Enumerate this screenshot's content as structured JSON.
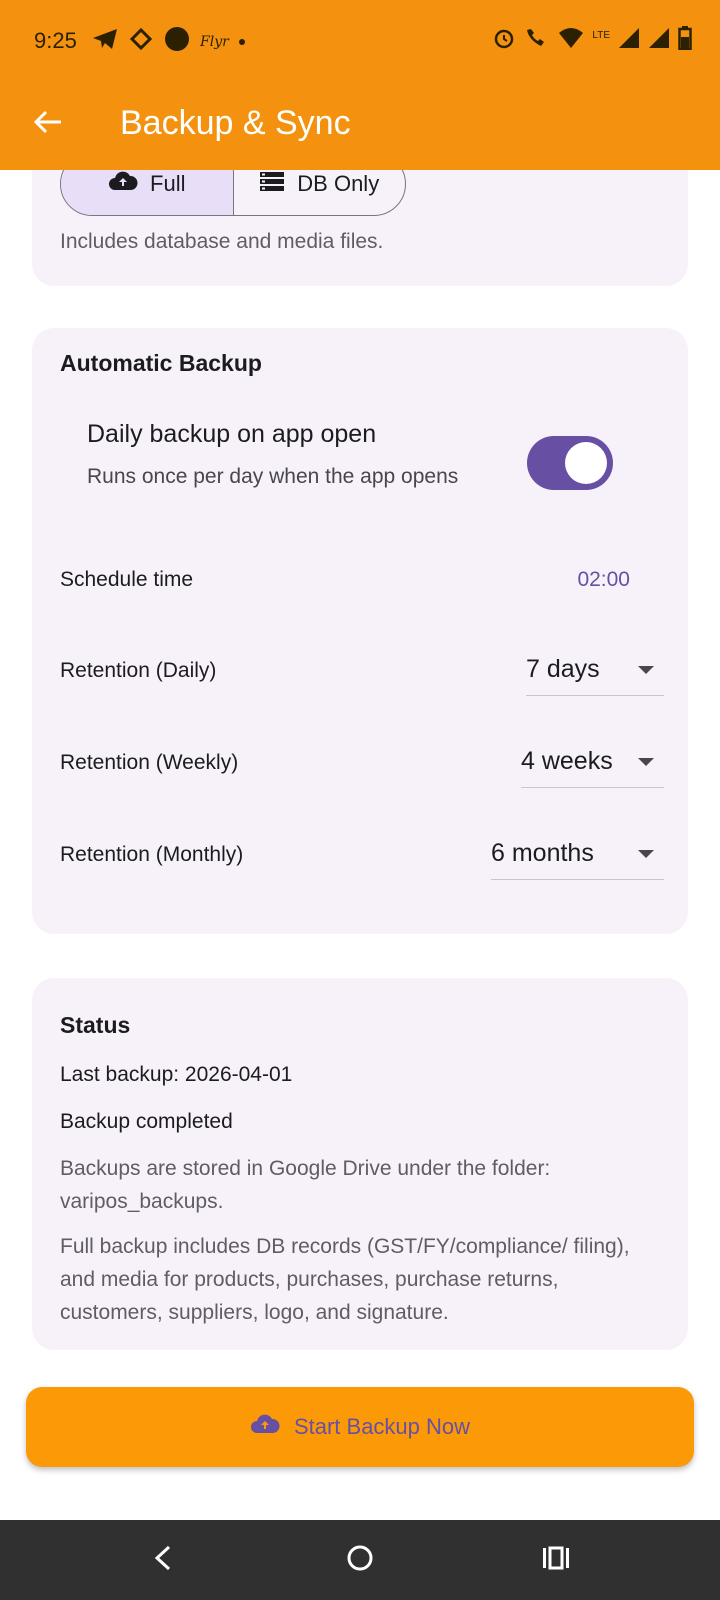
{
  "status_bar": {
    "time": "9:25",
    "carrier_text": "Flyr",
    "network": "LTE",
    "left_icons": [
      "telegram-icon",
      "sync-app-icon",
      "circle-app-icon"
    ],
    "right_icons": [
      "alarm-icon",
      "call-wifi-icon",
      "wifi-icon",
      "signal-icon",
      "signal-icon",
      "battery-icon"
    ]
  },
  "app_bar": {
    "title": "Backup & Sync",
    "back_icon": "arrow-left-icon",
    "color": "#f4920f"
  },
  "backup_type": {
    "options": [
      {
        "label": "Full",
        "icon": "cloud-upload-icon",
        "selected": true
      },
      {
        "label": "DB Only",
        "icon": "storage-icon",
        "selected": false
      }
    ],
    "description": "Includes database and media files."
  },
  "automatic_backup": {
    "title": "Automatic Backup",
    "daily_toggle": {
      "title": "Daily backup on app open",
      "subtitle": "Runs once per day when the app opens",
      "enabled": true
    },
    "schedule": {
      "label": "Schedule time",
      "value": "02:00"
    },
    "retention": [
      {
        "label": "Retention (Daily)",
        "value": "7 days"
      },
      {
        "label": "Retention (Weekly)",
        "value": "4 weeks"
      },
      {
        "label": "Retention (Monthly)",
        "value": "6 months"
      }
    ]
  },
  "status": {
    "title": "Status",
    "last_backup": "Last backup: 2026-04-01",
    "state": "Backup completed",
    "note_storage": "Backups are stored in Google Drive under the folder: varipos_backups.",
    "note_full": "Full backup includes DB records (GST/FY/compliance/ filing), and media for products, purchases, purchase returns, customers, suppliers, logo, and signature."
  },
  "action": {
    "label": "Start Backup Now",
    "icon": "cloud-upload-icon",
    "color": "#fb9a06"
  },
  "colors": {
    "accent": "#6750a4",
    "card_bg": "#f7f2fa"
  },
  "nav_bar": {
    "buttons": [
      "back-icon",
      "home-icon",
      "recents-icon"
    ]
  }
}
